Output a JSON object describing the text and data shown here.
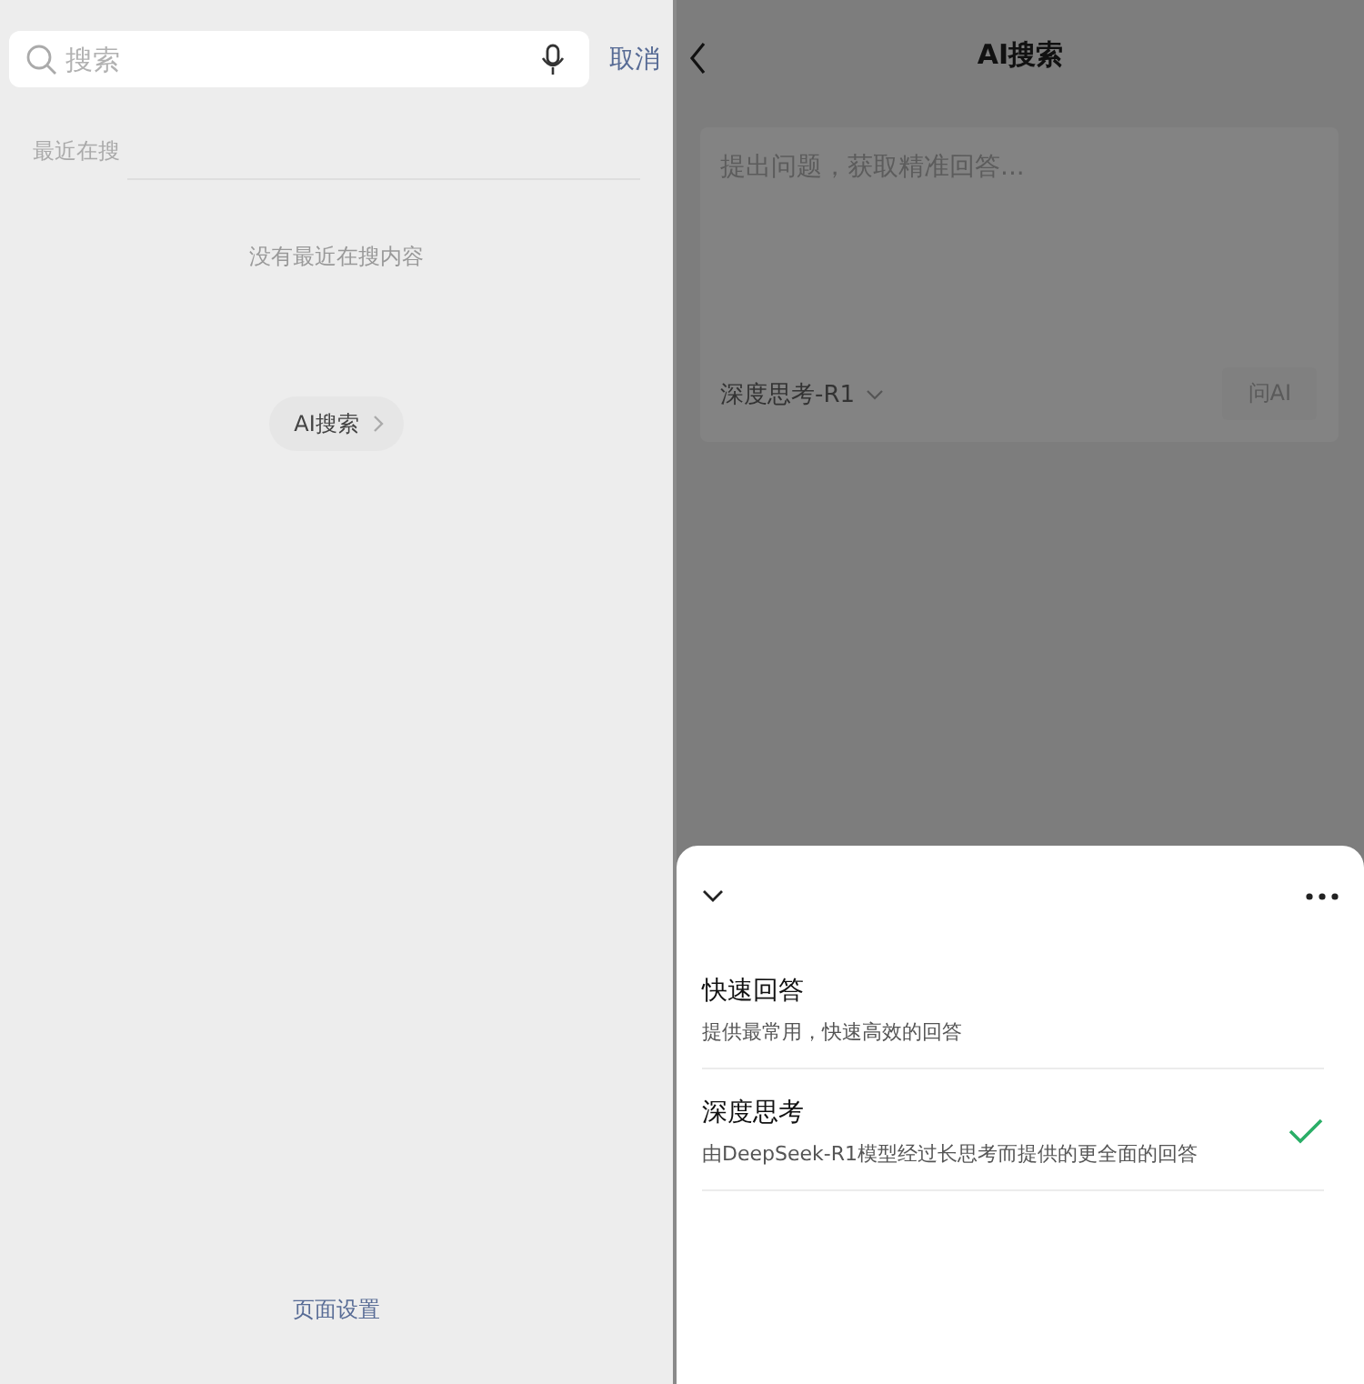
{
  "search_screen": {
    "search": {
      "placeholder": "搜索"
    },
    "cancel": "取消",
    "recent": {
      "title": "最近在搜",
      "empty_text": "没有最近在搜内容"
    },
    "ai_search_button": "AI搜索",
    "page_settings": "页面设置"
  },
  "ai_screen": {
    "title": "AI搜索",
    "question_box": {
      "placeholder": "提出问题，获取精准回答...",
      "model_label": "深度思考-R1",
      "ask_button": "问AI"
    },
    "sheet": {
      "options": [
        {
          "title": "快速回答",
          "description": "提供最常用，快速高效的回答",
          "selected": false
        },
        {
          "title": "深度思考",
          "description": "由DeepSeek-R1模型经过长思考而提供的更全面的回答",
          "selected": true
        }
      ]
    }
  }
}
